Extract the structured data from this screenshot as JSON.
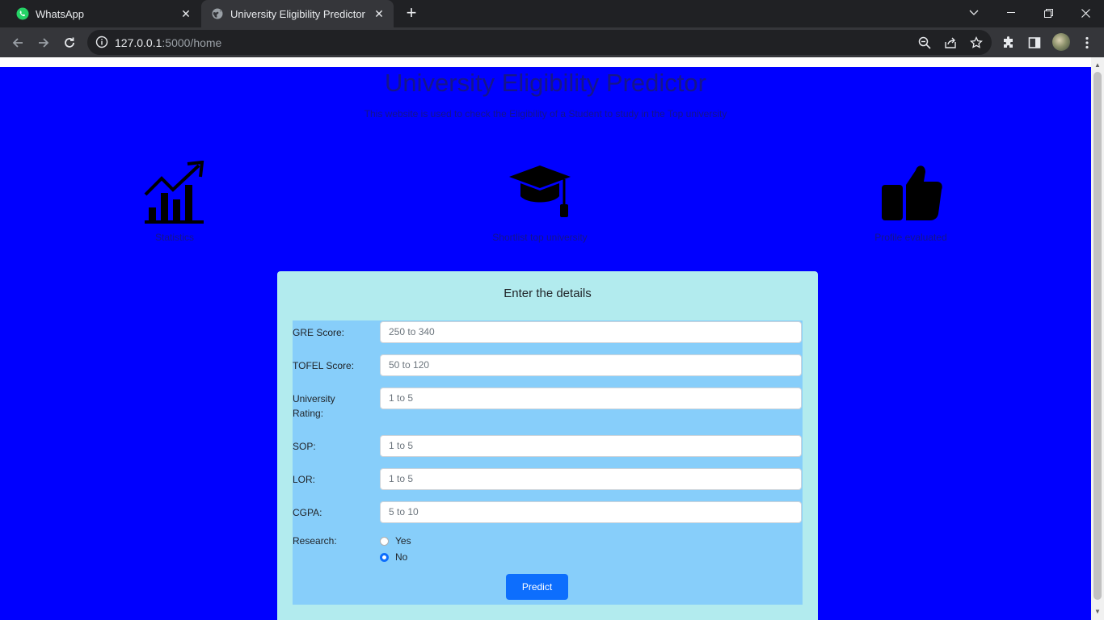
{
  "browser": {
    "tabs": [
      {
        "title": "WhatsApp",
        "icon": "whatsapp-icon"
      },
      {
        "title": "University Eligibility Predictor",
        "icon": "globe-icon"
      }
    ],
    "address": {
      "host": "127.0.0.1",
      "path": ":5000/home"
    }
  },
  "page": {
    "title": "University Eligibility Predictor",
    "subtitle": "This website is used to check the Eligibility of a Student to study in the Top university",
    "features": [
      {
        "label": "Statistics",
        "icon": "chart-growth-icon"
      },
      {
        "label": "Shortlist top university",
        "icon": "graduation-cap-icon"
      },
      {
        "label": "Profile evaluated",
        "icon": "thumbs-up-icon"
      }
    ],
    "colors": {
      "background": "#0000ff",
      "card": "#b2ebee",
      "form": "#87cefa",
      "button": "#0d6efd"
    }
  },
  "form": {
    "heading": "Enter the details",
    "fields": [
      {
        "label": "GRE Score:",
        "placeholder": "250 to 340"
      },
      {
        "label": "TOFEL Score:",
        "placeholder": "50 to 120"
      },
      {
        "label": "University Rating:",
        "placeholder": "1 to 5"
      },
      {
        "label": "SOP:",
        "placeholder": "1 to 5"
      },
      {
        "label": "LOR:",
        "placeholder": "1 to 5"
      },
      {
        "label": "CGPA:",
        "placeholder": "5 to 10"
      }
    ],
    "research": {
      "label": "Research:",
      "options": [
        {
          "label": "Yes",
          "checked": false
        },
        {
          "label": "No",
          "checked": true
        }
      ]
    },
    "submit_label": "Predict"
  }
}
